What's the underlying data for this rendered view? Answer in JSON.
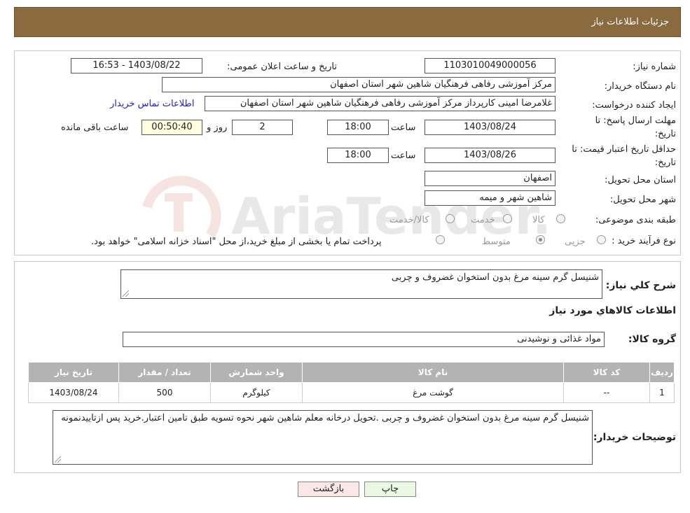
{
  "header": {
    "title": "جزئیات اطلاعات نیاز"
  },
  "need_number": {
    "label": "شماره نیاز:",
    "value": "1103010049000056"
  },
  "announce_datetime": {
    "label": "تاریخ و ساعت اعلان عمومی:",
    "value": "1403/08/22 - 16:53"
  },
  "buyer_org": {
    "label": "نام دستگاه خریدار:",
    "value": "مرکز آموزشی رفاهی فرهنگیان شاهین شهر استان اصفهان"
  },
  "requester": {
    "label": "ایجاد کننده درخواست:",
    "value": "غلامرضا امینی کارپرداز مرکز آموزشی رفاهی فرهنگیان شاهین شهر استان اصفهان",
    "contact_link": "اطلاعات تماس خریدار"
  },
  "reply_deadline": {
    "label_line1": "مهلت ارسال پاسخ: تا",
    "label_line2": "تاریخ:",
    "date": "1403/08/24",
    "time_label": "ساعت",
    "time": "18:00",
    "days": "2",
    "days_label": "روز و",
    "remaining": "00:50:40",
    "remaining_label": "ساعت باقی مانده"
  },
  "price_validity": {
    "label_line1": "حداقل تاریخ اعتبار قیمت: تا",
    "label_line2": "تاریخ:",
    "date": "1403/08/26",
    "time_label": "ساعت",
    "time": "18:00"
  },
  "delivery_province": {
    "label": "استان محل تحویل:",
    "value": "اصفهان"
  },
  "delivery_city": {
    "label": "شهر محل تحویل:",
    "value": "شاهین شهر و میمه"
  },
  "category": {
    "label": "طبقه بندی موضوعی:",
    "options": [
      "کالا",
      "خدمت",
      "کالا/خدمت"
    ]
  },
  "purchase_type": {
    "label": "نوع فرآیند خرید :",
    "options": [
      "جزیی",
      "متوسط"
    ],
    "note": "پرداخت تمام یا بخشی از مبلغ خرید،از محل \"اسناد خزانه اسلامی\" خواهد بود."
  },
  "general_desc": {
    "label": "شرح كلي نياز:",
    "value": "شنیسل گرم سینه مرغ بدون استخوان غضروف و چربی"
  },
  "goods_section": {
    "title": "اطلاعات كالاهاي مورد نياز"
  },
  "goods_group": {
    "label": "گروه كالا:",
    "value": "مواد غذائی و نوشیدنی"
  },
  "items_table": {
    "headers": [
      "ردیف",
      "کد کالا",
      "نام کالا",
      "واحد شمارش",
      "تعداد / مقدار",
      "تاریخ نیاز"
    ],
    "rows": [
      [
        "1",
        "--",
        "گوشت مرغ",
        "کیلوگرم",
        "500",
        "1403/08/24"
      ]
    ]
  },
  "buyer_notes": {
    "label": "توضیحات خریدار:",
    "value": "شنیسل گرم سینه مرغ بدون استخوان غضروف و چربی .تحویل درخانه معلم شاهین شهر نحوه تسویه طبق تامین اعتبار.خرید پس ازتاییدنمونه"
  },
  "buttons": {
    "print": "چاپ",
    "back": "بازگشت"
  },
  "watermark": {
    "text": "AriaTender.neT"
  }
}
